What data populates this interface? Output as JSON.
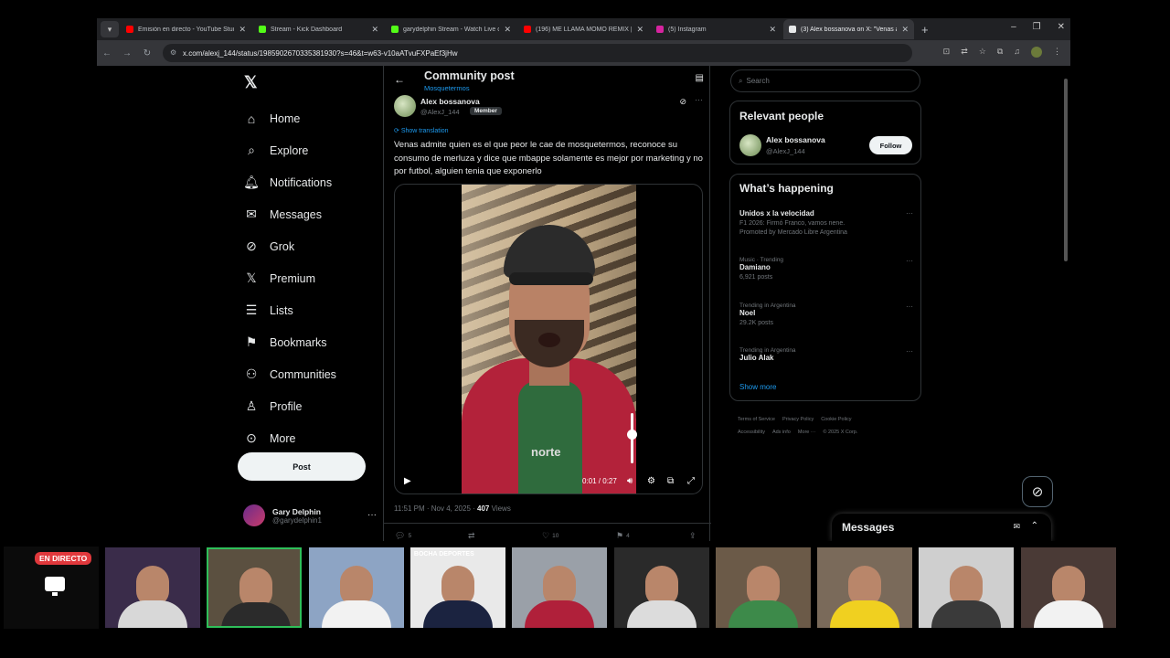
{
  "browser": {
    "tabs": [
      {
        "title": "Emisión en directo - YouTube Studio",
        "color": "#ff0000",
        "active": false
      },
      {
        "title": "Stream - Kick Dashboard",
        "color": "#53fc18",
        "active": false
      },
      {
        "title": "garydelphin Stream - Watch Live on Kick",
        "color": "#53fc18",
        "active": false
      },
      {
        "title": "(196) ME LLAMA MOMO REMIX | ...",
        "color": "#ff0000",
        "active": false
      },
      {
        "title": "(5) Instagram",
        "color": "#d6249f",
        "active": false
      },
      {
        "title": "(3) Alex bossanova on X: \"Venas admite...",
        "color": "#e7e9ea",
        "active": true
      }
    ],
    "url": "x.com/alexj_144/status/1985902670335381930?s=46&t=w63-v10aATvuFXPaEf3jHw"
  },
  "nav": {
    "items": [
      {
        "label": "Home",
        "icon": "home-icon",
        "glyph": "⌂"
      },
      {
        "label": "Explore",
        "icon": "search-icon",
        "glyph": "⌕"
      },
      {
        "label": "Notifications",
        "icon": "bell-icon",
        "glyph": "🔔︎"
      },
      {
        "label": "Messages",
        "icon": "mail-icon",
        "glyph": "✉"
      },
      {
        "label": "Grok",
        "icon": "grok-icon",
        "glyph": "⊘"
      },
      {
        "label": "Premium",
        "icon": "x-logo-icon",
        "glyph": "𝕏"
      },
      {
        "label": "Lists",
        "icon": "list-icon",
        "glyph": "☰"
      },
      {
        "label": "Bookmarks",
        "icon": "bookmark-icon",
        "glyph": "⚑"
      },
      {
        "label": "Communities",
        "icon": "people-icon",
        "glyph": "⚇"
      },
      {
        "label": "Profile",
        "icon": "person-icon",
        "glyph": "♙"
      },
      {
        "label": "More",
        "icon": "more-circle-icon",
        "glyph": "⊙"
      }
    ],
    "post_label": "Post",
    "user": {
      "name": "Gary Delphin",
      "handle": "@garydelphin1"
    }
  },
  "post": {
    "header_title": "Community post",
    "community": "Mosquetermos",
    "author_name": "Alex bossanova",
    "author_handle": "@AlexJ_144",
    "member_label": "Member",
    "show_translation": "Show translation",
    "text": "Venas admite quien es el que peor le cae de mosquetermos, reconoce su consumo de merluza y dice que mbappe solamente es mejor por marketing y no por futbol, alguien tenia que exponerlo",
    "video_time": "0:01 / 0:27",
    "shirt_text": "norte",
    "volume_level": 0.65,
    "timestamp": "11:51 PM · Nov 4, 2025 ·",
    "views_count": "407",
    "views_label": "Views",
    "stats": {
      "replies": "5",
      "likes": "10",
      "bookmarks": "4"
    }
  },
  "right": {
    "search_placeholder": "Search",
    "relevant_title": "Relevant people",
    "person_name": "Alex bossanova",
    "person_handle": "@AlexJ_144",
    "follow_label": "Follow",
    "happening_title": "What’s happening",
    "trends": [
      {
        "category": "",
        "name": "Unidos x la velocidad",
        "sub": "F1 2026: Firmó Franco, vamos nene.",
        "extra": "Promoted by Mercado Libre Argentina"
      },
      {
        "category": "Music · Trending",
        "name": "Damiano",
        "sub": "6,921 posts",
        "extra": ""
      },
      {
        "category": "Trending in Argentina",
        "name": "Noel",
        "sub": "29.2K posts",
        "extra": ""
      },
      {
        "category": "Trending in Argentina",
        "name": "Julio Alak",
        "sub": "",
        "extra": ""
      }
    ],
    "show_more": "Show more",
    "footer_line1": [
      "Terms of Service",
      "Privacy Policy",
      "Cookie Policy"
    ],
    "footer_line2": [
      "Accessibility",
      "Ads info",
      "More ···",
      "© 2025 X Corp."
    ],
    "messages_label": "Messages"
  },
  "stream": {
    "live_label": "EN DIRECTO",
    "cams": [
      {
        "bg": "#3a2c4a",
        "shirt": "#d8d8d8",
        "caption": ""
      },
      {
        "bg": "#5b5040",
        "shirt": "#2b2b2b",
        "caption": ""
      },
      {
        "bg": "#8da4c4",
        "shirt": "#f2f2f2",
        "caption": ""
      },
      {
        "bg": "#e9e9e9",
        "shirt": "#1b2340",
        "caption": "BOCHA DEPORTES"
      },
      {
        "bg": "#9aa0a8",
        "shirt": "#b0203a",
        "caption": ""
      },
      {
        "bg": "#2a2a2a",
        "shirt": "#dcdcdc",
        "caption": ""
      },
      {
        "bg": "#6b5a48",
        "shirt": "#3d8a4a",
        "caption": ""
      },
      {
        "bg": "#7a6a5a",
        "shirt": "#f0d020",
        "caption": ""
      },
      {
        "bg": "#cfcfcf",
        "shirt": "#3a3a3a",
        "caption": ""
      },
      {
        "bg": "#4a3a36",
        "shirt": "#f2f2f2",
        "caption": ""
      }
    ]
  }
}
